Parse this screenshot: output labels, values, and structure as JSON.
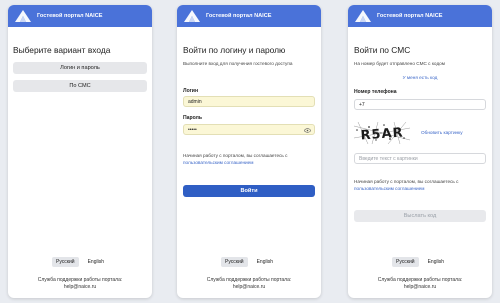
{
  "header_title": "Гостевой портал NAICE",
  "languages": {
    "active": "Русский",
    "other": "English"
  },
  "support": {
    "line1": "Служба поддержки работы портала:",
    "line2": "help@naice.ru"
  },
  "colors": {
    "header": "#4a72d9",
    "primary_button": "#2f5ec4",
    "input_fill": "#fbf7d6",
    "link": "#3a66c8"
  },
  "panel1": {
    "title": "Выберите вариант входа",
    "login_password_button": "Логин и пароль",
    "sms_button": "По СМС"
  },
  "panel2": {
    "title": "Войти по логину и паролю",
    "subtitle": "Выполните вход для получения гостевого доступа",
    "login_label": "Логин",
    "login_value": "admin",
    "password_label": "Пароль",
    "password_value": "•••••",
    "agreement_text": "Начиная работу с порталом, вы соглашаетесь с",
    "agreement_link": "пользовательским соглашением",
    "submit": "Войти"
  },
  "panel3": {
    "title": "Войти по СМС",
    "info": "На номер будет отправлено СМС с кодом",
    "have_code_link": "У меня есть код",
    "phone_label": "Номер телефона",
    "phone_value": "+7",
    "captcha_text": "R5AR",
    "refresh_captcha": "Обновить картинку",
    "captcha_placeholder": "Введите текст с картинки",
    "agreement_text": "Начиная работу с порталом, вы соглашаетесь с",
    "agreement_link": "пользовательским соглашением",
    "send_code": "Выслать код"
  }
}
